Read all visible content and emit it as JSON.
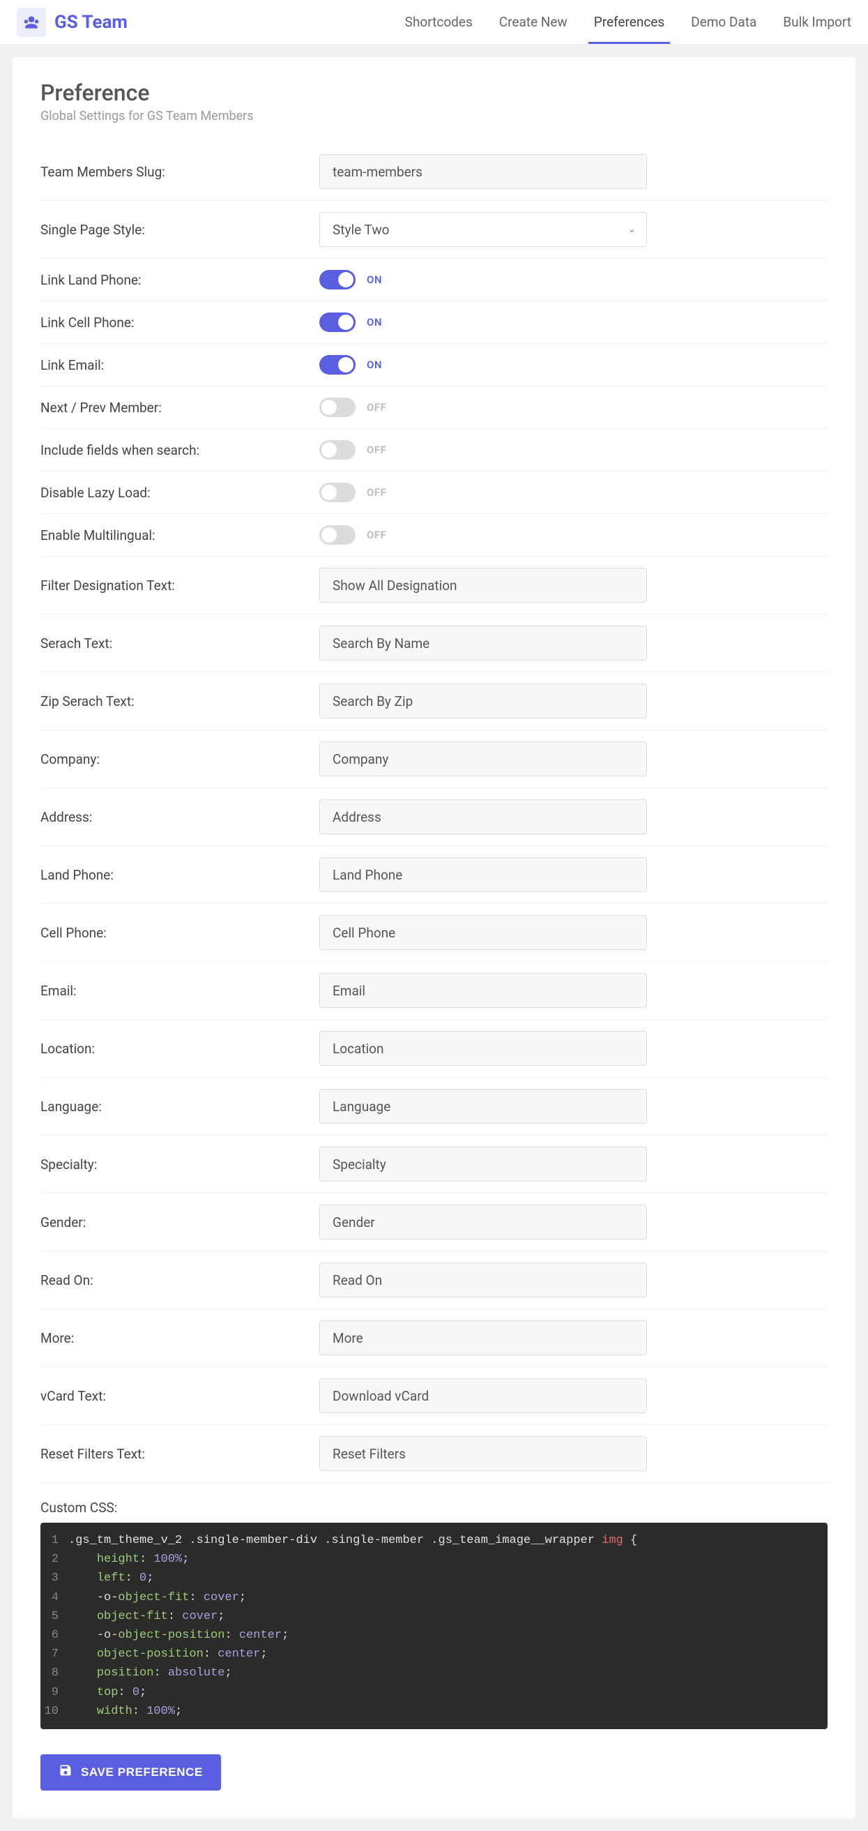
{
  "brand": {
    "name": "GS Team"
  },
  "nav": {
    "items": [
      {
        "label": "Shortcodes",
        "active": false
      },
      {
        "label": "Create New",
        "active": false
      },
      {
        "label": "Preferences",
        "active": true
      },
      {
        "label": "Demo Data",
        "active": false
      },
      {
        "label": "Bulk Import",
        "active": false
      }
    ]
  },
  "header": {
    "title": "Preference",
    "subtitle": "Global Settings for GS Team Members"
  },
  "toggle_labels": {
    "on": "ON",
    "off": "OFF"
  },
  "fields": [
    {
      "type": "text",
      "label": "Team Members Slug:",
      "value": "team-members"
    },
    {
      "type": "select",
      "label": "Single Page Style:",
      "value": "Style Two"
    },
    {
      "type": "toggle",
      "label": "Link Land Phone:",
      "value": true
    },
    {
      "type": "toggle",
      "label": "Link Cell Phone:",
      "value": true
    },
    {
      "type": "toggle",
      "label": "Link Email:",
      "value": true
    },
    {
      "type": "toggle",
      "label": "Next / Prev Member:",
      "value": false
    },
    {
      "type": "toggle",
      "label": "Include fields when search:",
      "value": false
    },
    {
      "type": "toggle",
      "label": "Disable Lazy Load:",
      "value": false
    },
    {
      "type": "toggle",
      "label": "Enable Multilingual:",
      "value": false
    },
    {
      "type": "text",
      "label": "Filter Designation Text:",
      "value": "Show All Designation"
    },
    {
      "type": "text",
      "label": "Serach Text:",
      "value": "Search By Name"
    },
    {
      "type": "text",
      "label": "Zip Serach Text:",
      "value": "Search By Zip"
    },
    {
      "type": "text",
      "label": "Company:",
      "value": "Company"
    },
    {
      "type": "text",
      "label": "Address:",
      "value": "Address"
    },
    {
      "type": "text",
      "label": "Land Phone:",
      "value": "Land Phone"
    },
    {
      "type": "text",
      "label": "Cell Phone:",
      "value": "Cell Phone"
    },
    {
      "type": "text",
      "label": "Email:",
      "value": "Email"
    },
    {
      "type": "text",
      "label": "Location:",
      "value": "Location"
    },
    {
      "type": "text",
      "label": "Language:",
      "value": "Language"
    },
    {
      "type": "text",
      "label": "Specialty:",
      "value": "Specialty"
    },
    {
      "type": "text",
      "label": "Gender:",
      "value": "Gender"
    },
    {
      "type": "text",
      "label": "Read On:",
      "value": "Read On"
    },
    {
      "type": "text",
      "label": "More:",
      "value": "More"
    },
    {
      "type": "text",
      "label": "vCard Text:",
      "value": "Download vCard"
    },
    {
      "type": "text",
      "label": "Reset Filters Text:",
      "value": "Reset Filters"
    }
  ],
  "custom_css": {
    "label": "Custom CSS:",
    "lines": [
      [
        {
          "t": "sel",
          "v": ".gs_tm_theme_v_2 .single-member-div .single-member .gs_team_image__wrapper "
        },
        {
          "t": "tag",
          "v": "img"
        },
        {
          "t": "brace",
          "v": " {"
        }
      ],
      [
        {
          "t": "indent",
          "v": "    "
        },
        {
          "t": "prop",
          "v": "height"
        },
        {
          "t": "punc",
          "v": ": "
        },
        {
          "t": "num",
          "v": "100%"
        },
        {
          "t": "punc",
          "v": ";"
        }
      ],
      [
        {
          "t": "indent",
          "v": "    "
        },
        {
          "t": "prop",
          "v": "left"
        },
        {
          "t": "punc",
          "v": ": "
        },
        {
          "t": "num",
          "v": "0"
        },
        {
          "t": "punc",
          "v": ";"
        }
      ],
      [
        {
          "t": "indent",
          "v": "    "
        },
        {
          "t": "punc",
          "v": "-o-"
        },
        {
          "t": "prop",
          "v": "object-fit"
        },
        {
          "t": "punc",
          "v": ": "
        },
        {
          "t": "propv",
          "v": "cover"
        },
        {
          "t": "punc",
          "v": ";"
        }
      ],
      [
        {
          "t": "indent",
          "v": "    "
        },
        {
          "t": "prop",
          "v": "object-fit"
        },
        {
          "t": "punc",
          "v": ": "
        },
        {
          "t": "propv",
          "v": "cover"
        },
        {
          "t": "punc",
          "v": ";"
        }
      ],
      [
        {
          "t": "indent",
          "v": "    "
        },
        {
          "t": "punc",
          "v": "-o-"
        },
        {
          "t": "prop",
          "v": "object-position"
        },
        {
          "t": "punc",
          "v": ": "
        },
        {
          "t": "propv",
          "v": "center"
        },
        {
          "t": "punc",
          "v": ";"
        }
      ],
      [
        {
          "t": "indent",
          "v": "    "
        },
        {
          "t": "prop",
          "v": "object-position"
        },
        {
          "t": "punc",
          "v": ": "
        },
        {
          "t": "propv",
          "v": "center"
        },
        {
          "t": "punc",
          "v": ";"
        }
      ],
      [
        {
          "t": "indent",
          "v": "    "
        },
        {
          "t": "prop",
          "v": "position"
        },
        {
          "t": "punc",
          "v": ": "
        },
        {
          "t": "propv",
          "v": "absolute"
        },
        {
          "t": "punc",
          "v": ";"
        }
      ],
      [
        {
          "t": "indent",
          "v": "    "
        },
        {
          "t": "prop",
          "v": "top"
        },
        {
          "t": "punc",
          "v": ": "
        },
        {
          "t": "num",
          "v": "0"
        },
        {
          "t": "punc",
          "v": ";"
        }
      ],
      [
        {
          "t": "indent",
          "v": "    "
        },
        {
          "t": "prop",
          "v": "width"
        },
        {
          "t": "punc",
          "v": ": "
        },
        {
          "t": "num",
          "v": "100%"
        },
        {
          "t": "punc",
          "v": ";"
        }
      ]
    ]
  },
  "save_button": "SAVE PREFERENCE"
}
